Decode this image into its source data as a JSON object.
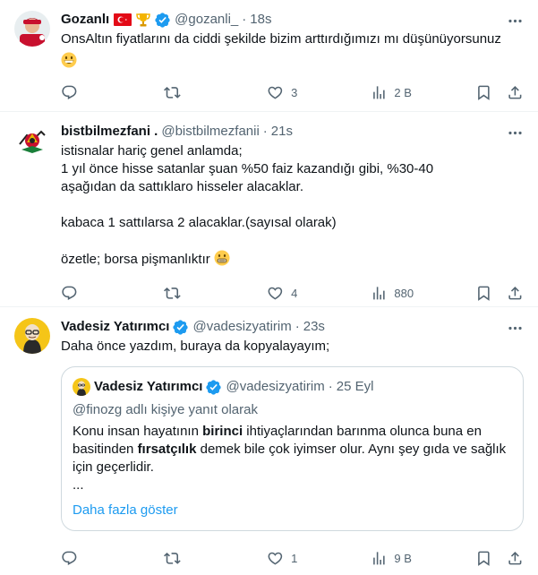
{
  "colors": {
    "accent": "#1d9bf0",
    "secondary_text": "#536471",
    "border": "#eff3f4"
  },
  "tweets": [
    {
      "name": "Gozanlı",
      "badges": [
        "turkey-flag-icon",
        "trophy-icon",
        "verified-icon"
      ],
      "handle": "@gozanli_",
      "time": "18s",
      "text": "OnsAltın fiyatlarını da ciddi şekilde bizim arttırdığımızı mı düşünüyorsunuz",
      "emoji": "grinning-emoji",
      "replies": "",
      "retweets": "",
      "likes": "3",
      "views": "2 B"
    },
    {
      "name": "bistbilmezfani .",
      "handle": "@bistbilmezfanii",
      "time": "21s",
      "lines": [
        "istisnalar hariç genel anlamda;",
        "1 yıl önce hisse satanlar şuan %50 faiz kazandığı gibi, %30-40",
        "aşağıdan da sattıklaro hisseler alacaklar.",
        "",
        "kabaca 1 sattılarsa 2 alacaklar.(sayısal olarak)",
        "",
        "özetle; borsa pişmanlıktır"
      ],
      "emoji": "grimacing-emoji",
      "replies": "",
      "retweets": "",
      "likes": "4",
      "views": "880"
    },
    {
      "name": "Vadesiz Yatırımcı",
      "handle": "@vadesizyatirim",
      "time": "23s",
      "text": "Daha önce yazdım, buraya da kopyalayayım;",
      "quote": {
        "name": "Vadesiz Yatırımcı",
        "handle": "@vadesizyatirim",
        "time": "25 Eyl",
        "reply_to": "@finozg adlı kişiye yanıt olarak",
        "text_parts": [
          "Konu insan hayatının ",
          "birinci",
          " ihtiyaçlarından barınma olunca buna en basitinden ",
          "fırsatçılık",
          " demek bile çok iyimser olur. Aynı şey gıda ve sağlık için geçerlidir."
        ],
        "ellipsis": "...",
        "show_more": "Daha fazla göster"
      },
      "replies": "",
      "retweets": "",
      "likes": "1",
      "views": "9 B"
    }
  ]
}
